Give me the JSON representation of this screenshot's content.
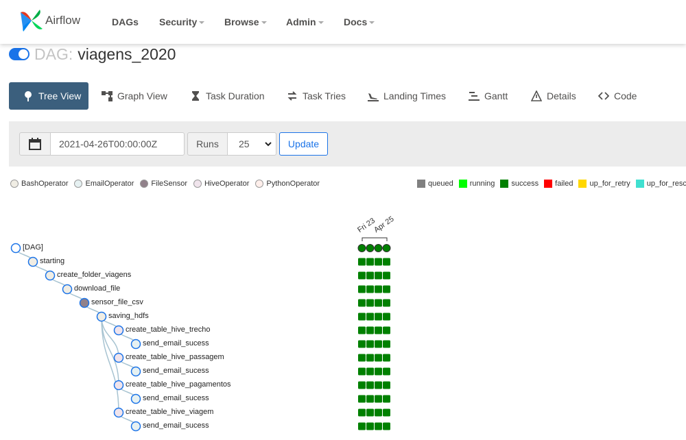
{
  "brand": {
    "name": "Airflow"
  },
  "nav": [
    {
      "label": "DAGs",
      "dropdown": false
    },
    {
      "label": "Security",
      "dropdown": true
    },
    {
      "label": "Browse",
      "dropdown": true
    },
    {
      "label": "Admin",
      "dropdown": true
    },
    {
      "label": "Docs",
      "dropdown": true
    }
  ],
  "title": {
    "prefix": "DAG:",
    "dag_id": "viagens_2020",
    "paused": false
  },
  "tabs": [
    {
      "label": "Tree View",
      "icon": "tree-icon",
      "active": true
    },
    {
      "label": "Graph View",
      "icon": "graph-icon"
    },
    {
      "label": "Task Duration",
      "icon": "hourglass-icon"
    },
    {
      "label": "Task Tries",
      "icon": "retry-icon"
    },
    {
      "label": "Landing Times",
      "icon": "plane-landing-icon"
    },
    {
      "label": "Gantt",
      "icon": "gantt-icon"
    },
    {
      "label": "Details",
      "icon": "warning-triangle-icon"
    },
    {
      "label": "Code",
      "icon": "code-icon"
    }
  ],
  "filter": {
    "base_date": "2021-04-26T00:00:00Z",
    "runs_label": "Runs",
    "runs_value": "25",
    "update_label": "Update"
  },
  "operators": [
    {
      "label": "BashOperator",
      "color": "#f0ede4"
    },
    {
      "label": "EmailOperator",
      "color": "#e6f1f2"
    },
    {
      "label": "FileSensor",
      "color": "#91818a"
    },
    {
      "label": "HiveOperator",
      "color": "#f0e4ec"
    },
    {
      "label": "PythonOperator",
      "color": "#ffefeb"
    }
  ],
  "states": [
    {
      "label": "queued",
      "color": "#808080"
    },
    {
      "label": "running",
      "color": "#00ff00"
    },
    {
      "label": "success",
      "color": "#008000"
    },
    {
      "label": "failed",
      "color": "#ff0000"
    },
    {
      "label": "up_for_retry",
      "color": "#ffd700"
    },
    {
      "label": "up_for_reschedule",
      "color": "#40e0d0"
    }
  ],
  "run_dates": [
    "Fri 23",
    "Apr 25"
  ],
  "tree": [
    {
      "label": "[DAG]",
      "depth": 0,
      "operator": "dag",
      "parent": null
    },
    {
      "label": "starting",
      "depth": 1,
      "operator": "BashOperator",
      "parent": 0
    },
    {
      "label": "create_folder_viagens",
      "depth": 2,
      "operator": "BashOperator",
      "parent": 1
    },
    {
      "label": "download_file",
      "depth": 3,
      "operator": "BashOperator",
      "parent": 2
    },
    {
      "label": "sensor_file_csv",
      "depth": 4,
      "operator": "FileSensor",
      "parent": 3
    },
    {
      "label": "saving_hdfs",
      "depth": 5,
      "operator": "BashOperator",
      "parent": 4
    },
    {
      "label": "create_table_hive_trecho",
      "depth": 6,
      "operator": "HiveOperator",
      "parent": 5
    },
    {
      "label": "send_email_sucess",
      "depth": 7,
      "operator": "EmailOperator",
      "parent": 6
    },
    {
      "label": "create_table_hive_passagem",
      "depth": 6,
      "operator": "HiveOperator",
      "parent": 5
    },
    {
      "label": "send_email_sucess",
      "depth": 7,
      "operator": "EmailOperator",
      "parent": 8
    },
    {
      "label": "create_table_hive_pagamentos",
      "depth": 6,
      "operator": "HiveOperator",
      "parent": 5
    },
    {
      "label": "send_email_sucess",
      "depth": 7,
      "operator": "EmailOperator",
      "parent": 10
    },
    {
      "label": "create_table_hive_viagem",
      "depth": 6,
      "operator": "HiveOperator",
      "parent": 5
    },
    {
      "label": "send_email_sucess",
      "depth": 7,
      "operator": "EmailOperator",
      "parent": 12
    }
  ],
  "runs_per_task": 4,
  "run_state": "success"
}
